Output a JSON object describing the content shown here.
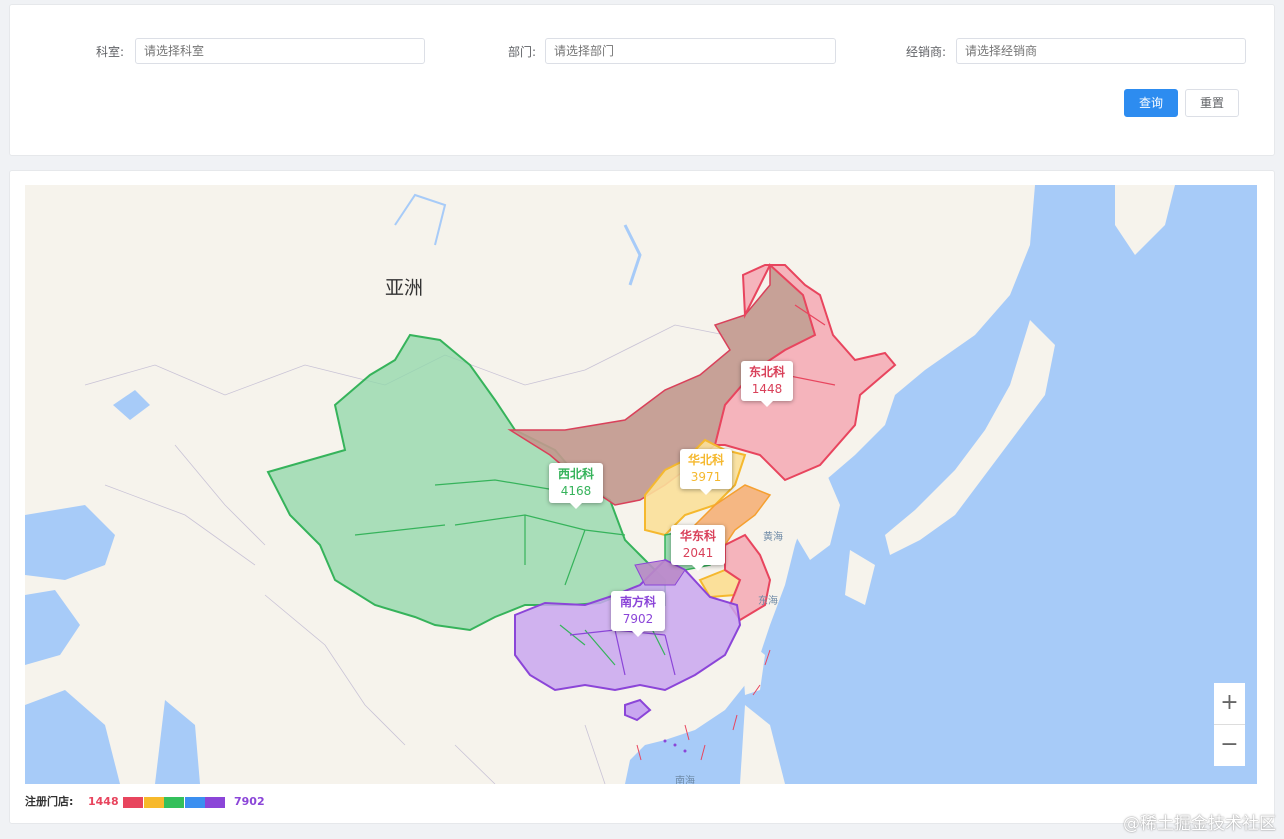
{
  "filters": {
    "department_label": "科室:",
    "department_placeholder": "请选择科室",
    "section_label": "部门:",
    "section_placeholder": "请选择部门",
    "dealer_label": "经销商:",
    "dealer_placeholder": "请选择经销商",
    "query_label": "查询",
    "reset_label": "重置"
  },
  "map": {
    "continent_label": "亚洲",
    "sea_labels": [
      "黄海",
      "东海",
      "南海"
    ],
    "zoom_in": "+",
    "zoom_out": "−",
    "regions": [
      {
        "name": "东北科",
        "value": "1448",
        "color": "#e8455e"
      },
      {
        "name": "西北科",
        "value": "4168",
        "color": "#36b35b"
      },
      {
        "name": "华北科",
        "value": "3971",
        "color": "#f5b82e"
      },
      {
        "name": "华东科",
        "value": "2041",
        "color": "#d9415a"
      },
      {
        "name": "南方科",
        "value": "7902",
        "color": "#8b45d8"
      }
    ]
  },
  "legend": {
    "title": "注册门店:",
    "min": "1448",
    "max": "7902",
    "colors": [
      "#e8455e",
      "#f7b92b",
      "#34c05b",
      "#3b8ff0",
      "#8b45d8"
    ]
  },
  "watermark": "@稀土掘金技术社区"
}
